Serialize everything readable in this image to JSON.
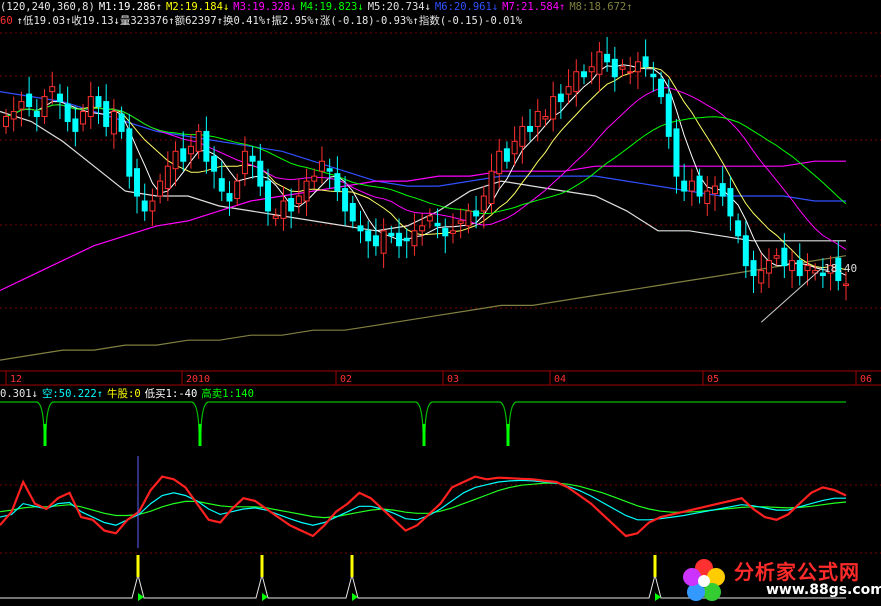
{
  "header": {
    "line1": [
      {
        "text": "(120,240,360,8)",
        "color": "#e8e8e8"
      },
      {
        "text": "M1:19.286↑",
        "color": "#ffffff"
      },
      {
        "text": "M2:19.184↓",
        "color": "#ffff00"
      },
      {
        "text": "M3:19.328↓",
        "color": "#ff00ff"
      },
      {
        "text": "M4:19.823↓",
        "color": "#00ff00"
      },
      {
        "text": "M5:20.734↓",
        "color": "#e0e0e0"
      },
      {
        "text": "M6:20.961↓",
        "color": "#3050ff"
      },
      {
        "text": "M7:21.584↑",
        "color": "#ff00ff"
      },
      {
        "text": "M8:18.672↑",
        "color": "#808040"
      }
    ],
    "line2": [
      {
        "text": "60",
        "color": "#ff3030"
      },
      {
        "text": "↑低19.03↑收19.13↓量323376↑额62397↑换0.41%↑振2.95%↑涨(-0.18)-0.93%↑指数(-0.15)-0.01%",
        "color": "#e8e8e8"
      }
    ]
  },
  "indicator_header": [
    {
      "text": "0.301↓",
      "color": "#e8e8e8"
    },
    {
      "text": "空:50.222↑",
      "color": "#00ffff"
    },
    {
      "text": "牛股:0",
      "color": "#ffff00"
    },
    {
      "text": "低买1:-40",
      "color": "#ffffff"
    },
    {
      "text": "高卖1:140",
      "color": "#00ff00"
    }
  ],
  "chart_data": [
    {
      "type": "candlestick",
      "title": "",
      "x_tick_labels": [
        "12",
        "2010",
        "02",
        "03",
        "04",
        "05",
        "06"
      ],
      "price_annotation": "18.40",
      "ma_legend": [
        {
          "name": "M1",
          "value": 19.286,
          "color": "#ffffff"
        },
        {
          "name": "M2",
          "value": 19.184,
          "color": "#ffff00"
        },
        {
          "name": "M3",
          "value": 19.328,
          "color": "#ff00ff"
        },
        {
          "name": "M4",
          "value": 19.823,
          "color": "#00ff00"
        },
        {
          "name": "M5",
          "value": 20.734,
          "color": "#e0e0e0"
        },
        {
          "name": "M6",
          "value": 20.961,
          "color": "#3050ff"
        },
        {
          "name": "M7",
          "value": 21.584,
          "color": "#ff00ff"
        },
        {
          "name": "M8",
          "value": 18.672,
          "color": "#808040"
        }
      ],
      "last_bar": {
        "low": 19.03,
        "close": 19.13,
        "volume": 323376,
        "amount": 62397,
        "turnover_pct": 0.41,
        "amplitude_pct": 2.95,
        "change": -0.18,
        "change_pct": -0.93
      },
      "ylim": [
        17.4,
        24.2
      ],
      "closes": [
        22.5,
        22.6,
        22.8,
        22.7,
        22.5,
        22.9,
        23.1,
        22.8,
        22.4,
        22.2,
        22.6,
        22.9,
        22.7,
        22.3,
        22.6,
        22.2,
        21.3,
        20.9,
        20.6,
        20.8,
        21.2,
        21.5,
        21.8,
        21.6,
        21.9,
        22.2,
        21.6,
        21.4,
        21.0,
        20.8,
        21.2,
        21.8,
        21.6,
        21.1,
        20.6,
        20.5,
        20.8,
        20.6,
        20.9,
        21.2,
        21.3,
        21.6,
        21.4,
        21.0,
        20.6,
        20.4,
        20.2,
        20.0,
        19.9,
        20.2,
        20.1,
        19.9,
        20.0,
        20.2,
        20.3,
        20.5,
        20.3,
        20.1,
        20.2,
        20.4,
        20.6,
        20.5,
        20.9,
        21.4,
        21.8,
        21.6,
        22.0,
        22.3,
        22.2,
        22.6,
        22.5,
        22.9,
        22.8,
        23.1,
        23.4,
        23.3,
        23.5,
        23.8,
        23.6,
        23.3,
        23.5,
        23.4,
        23.6,
        23.5,
        23.3,
        22.9,
        22.1,
        21.3,
        21.0,
        21.2,
        20.9,
        21.0,
        21.1,
        20.9,
        20.5,
        20.1,
        19.5,
        19.3,
        19.4,
        19.6,
        19.7,
        19.5,
        19.6,
        19.3,
        19.5,
        19.4,
        19.3,
        19.5,
        19.2,
        19.13
      ],
      "ma_series": [
        {
          "name": "M5",
          "color": "#e0e0e0",
          "values": [
            22.6,
            22.4,
            22.0,
            21.5,
            21.0,
            20.9,
            20.9,
            20.7,
            20.6,
            20.5,
            20.4,
            20.3,
            20.2,
            20.3,
            20.6,
            21.0,
            21.2,
            21.1,
            21.0,
            20.9,
            20.6,
            20.2,
            20.2,
            20.1,
            20.0,
            20.0,
            20.0,
            20.0
          ]
        },
        {
          "name": "M6",
          "color": "#3050ff",
          "values": [
            23.0,
            22.9,
            22.8,
            22.6,
            22.4,
            22.2,
            22.1,
            22.0,
            21.9,
            21.8,
            21.6,
            21.4,
            21.2,
            21.1,
            21.1,
            21.2,
            21.3,
            21.3,
            21.3,
            21.3,
            21.2,
            21.1,
            21.0,
            20.9,
            20.9,
            20.9,
            20.8,
            20.8
          ]
        },
        {
          "name": "M7",
          "color": "#ff00ff",
          "values": [
            19.0,
            19.3,
            19.6,
            19.9,
            20.1,
            20.3,
            20.4,
            20.6,
            20.8,
            20.9,
            21.0,
            21.1,
            21.2,
            21.2,
            21.3,
            21.3,
            21.4,
            21.4,
            21.4,
            21.5,
            21.5,
            21.5,
            21.5,
            21.5,
            21.5,
            21.5,
            21.6,
            21.6
          ]
        },
        {
          "name": "M8",
          "color": "#808040",
          "values": [
            17.6,
            17.7,
            17.8,
            17.8,
            17.9,
            17.9,
            18.0,
            18.0,
            18.1,
            18.1,
            18.2,
            18.2,
            18.3,
            18.4,
            18.5,
            18.6,
            18.7,
            18.7,
            18.8,
            18.9,
            19.0,
            19.1,
            19.2,
            19.3,
            19.4,
            19.5,
            19.6,
            19.7
          ]
        }
      ]
    },
    {
      "type": "line",
      "title": "",
      "ylim": [
        -40,
        140
      ],
      "series": [
        {
          "color": "#ff2020",
          "values": [
            30,
            55,
            110,
            70,
            60,
            80,
            90,
            45,
            40,
            20,
            15,
            40,
            55,
            95,
            120,
            115,
            100,
            70,
            40,
            35,
            60,
            80,
            75,
            60,
            45,
            30,
            20,
            10,
            30,
            55,
            70,
            90,
            80,
            60,
            40,
            20,
            30,
            50,
            70,
            100,
            110,
            120,
            115,
            118,
            117,
            116,
            115,
            112,
            110,
            100,
            85,
            70,
            50,
            30,
            10,
            15,
            35,
            45,
            50,
            55,
            60,
            65,
            70,
            75,
            80,
            60,
            45,
            40,
            50,
            70,
            90,
            100,
            95,
            85
          ]
        },
        {
          "color": "#00ffff",
          "values": [
            45,
            50,
            70,
            65,
            60,
            70,
            72,
            55,
            45,
            35,
            30,
            40,
            50,
            70,
            85,
            90,
            85,
            75,
            60,
            50,
            55,
            60,
            62,
            58,
            50,
            42,
            35,
            30,
            35,
            45,
            55,
            65,
            65,
            60,
            52,
            42,
            40,
            48,
            60,
            75,
            90,
            100,
            105,
            110,
            112,
            113,
            112,
            110,
            108,
            102,
            94,
            84,
            72,
            60,
            48,
            40,
            40,
            42,
            45,
            48,
            52,
            56,
            60,
            64,
            68,
            66,
            62,
            58,
            58,
            64,
            70,
            76,
            80,
            80
          ]
        },
        {
          "color": "#20ff20",
          "values": [
            55,
            58,
            62,
            64,
            64,
            66,
            68,
            64,
            58,
            52,
            48,
            48,
            50,
            56,
            64,
            70,
            74,
            74,
            70,
            66,
            64,
            64,
            64,
            62,
            58,
            54,
            50,
            46,
            44,
            46,
            50,
            54,
            58,
            60,
            58,
            54,
            52,
            52,
            56,
            62,
            70,
            78,
            86,
            94,
            100,
            104,
            106,
            108,
            108,
            106,
            102,
            96,
            90,
            82,
            74,
            66,
            60,
            56,
            54,
            54,
            55,
            57,
            59,
            61,
            63,
            64,
            64,
            63,
            62,
            63,
            65,
            68,
            71,
            73
          ]
        }
      ]
    }
  ]
}
